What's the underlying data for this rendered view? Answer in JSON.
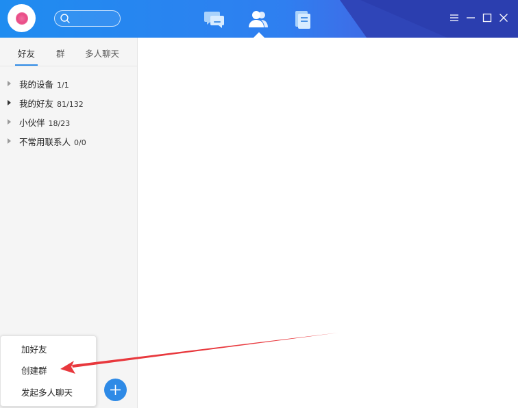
{
  "header": {
    "avatar_icon": "flower-avatar-icon",
    "search": {
      "placeholder": "",
      "icon": "search-icon"
    },
    "nav_tabs": [
      {
        "id": "messages",
        "icon": "chat-bubbles-icon",
        "active": false
      },
      {
        "id": "contacts",
        "icon": "contacts-icon",
        "active": true
      },
      {
        "id": "documents",
        "icon": "document-icon",
        "active": false
      }
    ],
    "window_controls": [
      "menu-icon",
      "minimize-icon",
      "maximize-icon",
      "close-icon"
    ]
  },
  "sidebar": {
    "tabs": [
      "好友",
      "群",
      "多人聊天"
    ],
    "active_tab": "好友",
    "groups": [
      {
        "label": "我的设备",
        "count": "1/1",
        "expanded": false
      },
      {
        "label": "我的好友",
        "count": "81/132",
        "expanded": true
      },
      {
        "label": "小伙伴",
        "count": "18/23",
        "expanded": false
      },
      {
        "label": "不常用联系人",
        "count": "0/0",
        "expanded": false
      }
    ]
  },
  "popup_menu": {
    "items": [
      "加好友",
      "创建群",
      "发起多人聊天"
    ]
  },
  "add_button": {
    "icon": "plus-icon"
  },
  "colors": {
    "header_blue": "#1f8cf0",
    "header_dark": "#2f45b8",
    "accent": "#2e8ae6",
    "annotation_arrow": "#e8383d"
  }
}
